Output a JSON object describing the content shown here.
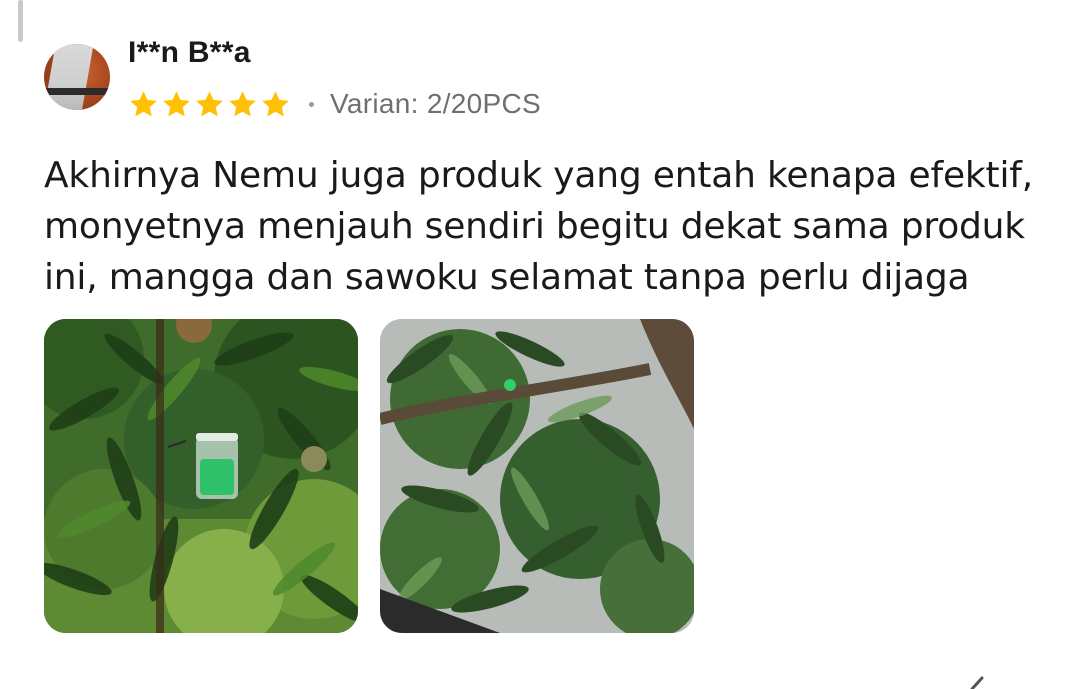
{
  "review": {
    "reviewer_name": "I**n B**a",
    "rating": 5,
    "rating_max": 5,
    "variant_text": "Varian: 2/20PCS",
    "body": "Akhirnya Nemu juga produk yang entah kenapa efektif, monyetnya menjauh sendiri begitu dekat sama produk ini, mangga dan sawoku selamat tanpa perlu dijaga",
    "photos": [
      {
        "subject": "mango tree with hanging green repellent jar"
      },
      {
        "subject": "mango tree branch canopy"
      }
    ]
  },
  "colors": {
    "star": "#FFC107",
    "text_primary": "#1a1a1a",
    "text_secondary": "#6f6f6f"
  },
  "icons": [
    "star-icon",
    "avatar",
    "pencil-icon"
  ]
}
